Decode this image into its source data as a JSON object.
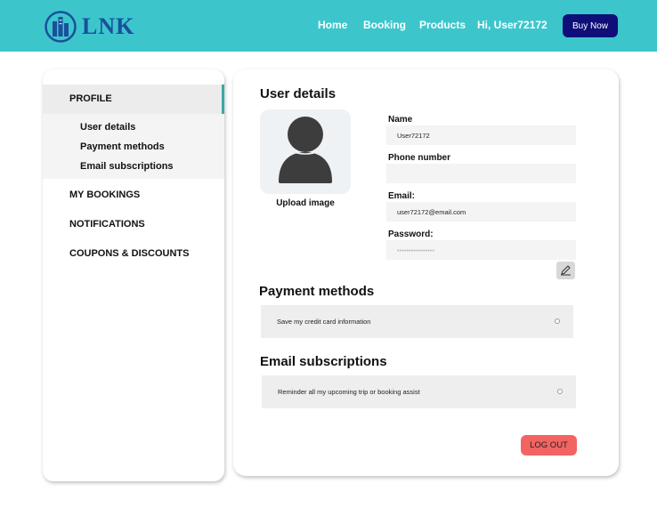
{
  "brand": {
    "name": "LNK",
    "colors": {
      "header": "#3cc6cc",
      "buy_button": "#0f0f7a",
      "logo": "#1a4f9c",
      "logout": "#f26462",
      "sidebar_active_bar": "#3aa8a8"
    }
  },
  "nav": {
    "home": "Home",
    "booking": "Booking",
    "products": "Products",
    "greeting": "Hi, User72172",
    "buy_now": "Buy Now"
  },
  "sidebar": {
    "profile": "PROFILE",
    "sub_items": [
      "User details",
      "Payment methods",
      "Email subscriptions"
    ],
    "my_bookings": "MY BOOKINGS",
    "notifications": "NOTIFICATIONS",
    "coupons": "COUPONS &  DISCOUNTS"
  },
  "user_details": {
    "title": "User details",
    "upload_label": "Upload image",
    "avatar_icon": "user-silhouette-icon",
    "fields": {
      "name_label": "Name",
      "name_value": "User72172",
      "phone_label": "Phone number",
      "phone_value": "",
      "email_label": "Email:",
      "email_value": "user72172@email.com",
      "password_label": "Password:",
      "password_value": "••••••••••••••••"
    },
    "edit_icon": "pencil-icon"
  },
  "payment_methods": {
    "title": "Payment methods",
    "option": "Save my credit card information"
  },
  "email_subscriptions": {
    "title": "Email subscriptions",
    "option": "Reminder all my upcoming trip or booking assist"
  },
  "logout": "LOG OUT"
}
